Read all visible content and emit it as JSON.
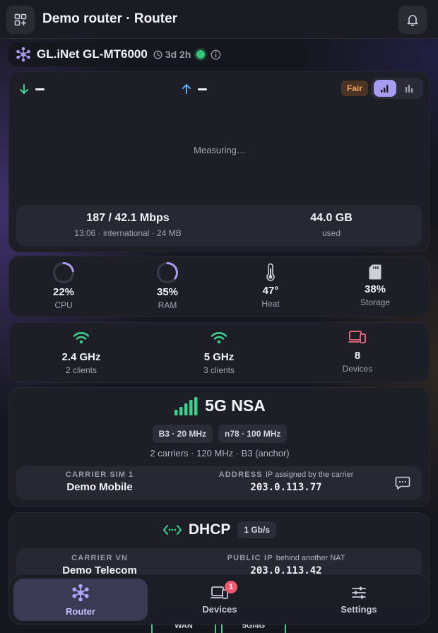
{
  "header": {
    "title": "Demo router · Router"
  },
  "device": {
    "name": "GL.iNet GL-MT6000",
    "uptime": "3d 2h",
    "status_color": "#34c77b"
  },
  "speed": {
    "download_value": "",
    "upload_value": "",
    "quality_badge": "Fair",
    "measuring_text": "Measuring…",
    "view_toggle": [
      "signal-bars-icon",
      "bar-chart-icon"
    ],
    "summary": {
      "rate": "187 / 42.1 Mbps",
      "rate_detail": "13:06 · international · 24 MB",
      "usage": "44.0 GB",
      "usage_label": "used"
    }
  },
  "system": {
    "cpu": {
      "value": "22%",
      "label": "CPU",
      "fraction": 0.22
    },
    "ram": {
      "value": "35%",
      "label": "RAM",
      "fraction": 0.35
    },
    "heat": {
      "value": "47°",
      "label": "Heat"
    },
    "storage": {
      "value": "38%",
      "label": "Storage"
    }
  },
  "wifi": {
    "band_24": {
      "value": "2.4 GHz",
      "label": "2 clients"
    },
    "band_5": {
      "value": "5 GHz",
      "label": "3 clients"
    },
    "devices": {
      "value": "8",
      "label": "Devices"
    }
  },
  "cellular": {
    "technology": "5G NSA",
    "bands": [
      "B3 · 20 MHz",
      "n78 · 100 MHz"
    ],
    "summary": "2 carriers · 120 MHz · B3 (anchor)",
    "carrier_label": "CARRIER",
    "carrier_sub": "SIM 1",
    "carrier_name": "Demo Mobile",
    "address_label": "ADDRESS",
    "address_sub": "IP assigned by the carrier",
    "address_value": "203.0.113.77"
  },
  "wan": {
    "mode": "DHCP",
    "link_speed": "1 Gb/s",
    "carrier_label": "CARRIER",
    "carrier_sub": "VN",
    "carrier_name": "Demo Telecom",
    "public_ip_label": "PUBLIC IP",
    "public_ip_sub": "behind another NAT",
    "public_ip_value": "203.0.113.42"
  },
  "peek": {
    "left": "WAN",
    "right": "5G/4G"
  },
  "nav": {
    "items": [
      {
        "label": "Router"
      },
      {
        "label": "Devices",
        "badge": "1"
      },
      {
        "label": "Settings"
      }
    ]
  },
  "colors": {
    "accent": "#a89cf2",
    "download": "#3ccf8e",
    "upload": "#5aa9f0",
    "fair": "#f3a35f",
    "alert": "#ef5a6f"
  }
}
